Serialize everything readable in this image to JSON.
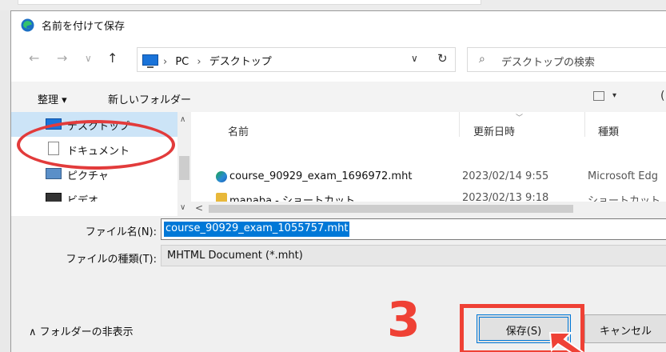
{
  "window": {
    "title": "名前を付けて保存"
  },
  "nav": {
    "back_icon": "←",
    "forward_icon": "→",
    "recent_icon": "∨",
    "up_icon": "↑",
    "breadcrumb": [
      "PC",
      "デスクトップ"
    ],
    "crumb_sep": "›",
    "dropdown_icon": "∨",
    "refresh_icon": "↻",
    "search_icon": "⌕",
    "search_placeholder": "デスクトップの検索"
  },
  "toolbar": {
    "organize_label": "整理 ▾",
    "new_folder_label": "新しいフォルダー",
    "view_arrow": "▾",
    "cut_glyph": "("
  },
  "sidebar": {
    "up_arrow": "∧",
    "down_arrow": "∨",
    "items": [
      {
        "label": "デスクトップ",
        "selected": true
      },
      {
        "label": "ドキュメント"
      },
      {
        "label": "ピクチャ"
      },
      {
        "label": "ビデオ"
      }
    ]
  },
  "files": {
    "columns": [
      "名前",
      "更新日時",
      "種類"
    ],
    "sort_indicator": "﹀",
    "rows": [
      {
        "name": "course_90929_exam_1696972.mht",
        "date": "2023/02/14 9:55",
        "type": "Microsoft Edg"
      },
      {
        "name": "manaba - ショートカット",
        "date": "2023/02/13 9:18",
        "type": "ショートカット"
      }
    ],
    "hscroll_left": "<"
  },
  "form": {
    "filename_label": "ファイル名(N):",
    "filename_value": "course_90929_exam_1055757.mht",
    "filetype_label": "ファイルの種類(T):",
    "filetype_value": "MHTML Document (*.mht)"
  },
  "footer": {
    "toggle_folders_label": "∧ フォルダーの非表示",
    "step_number": "3",
    "save_label": "保存(S)",
    "cancel_label": "キャンセル"
  },
  "colors": {
    "accent": "#0078d7",
    "annotation_red": "#ef4135",
    "selected_bg": "#cce4f7"
  }
}
